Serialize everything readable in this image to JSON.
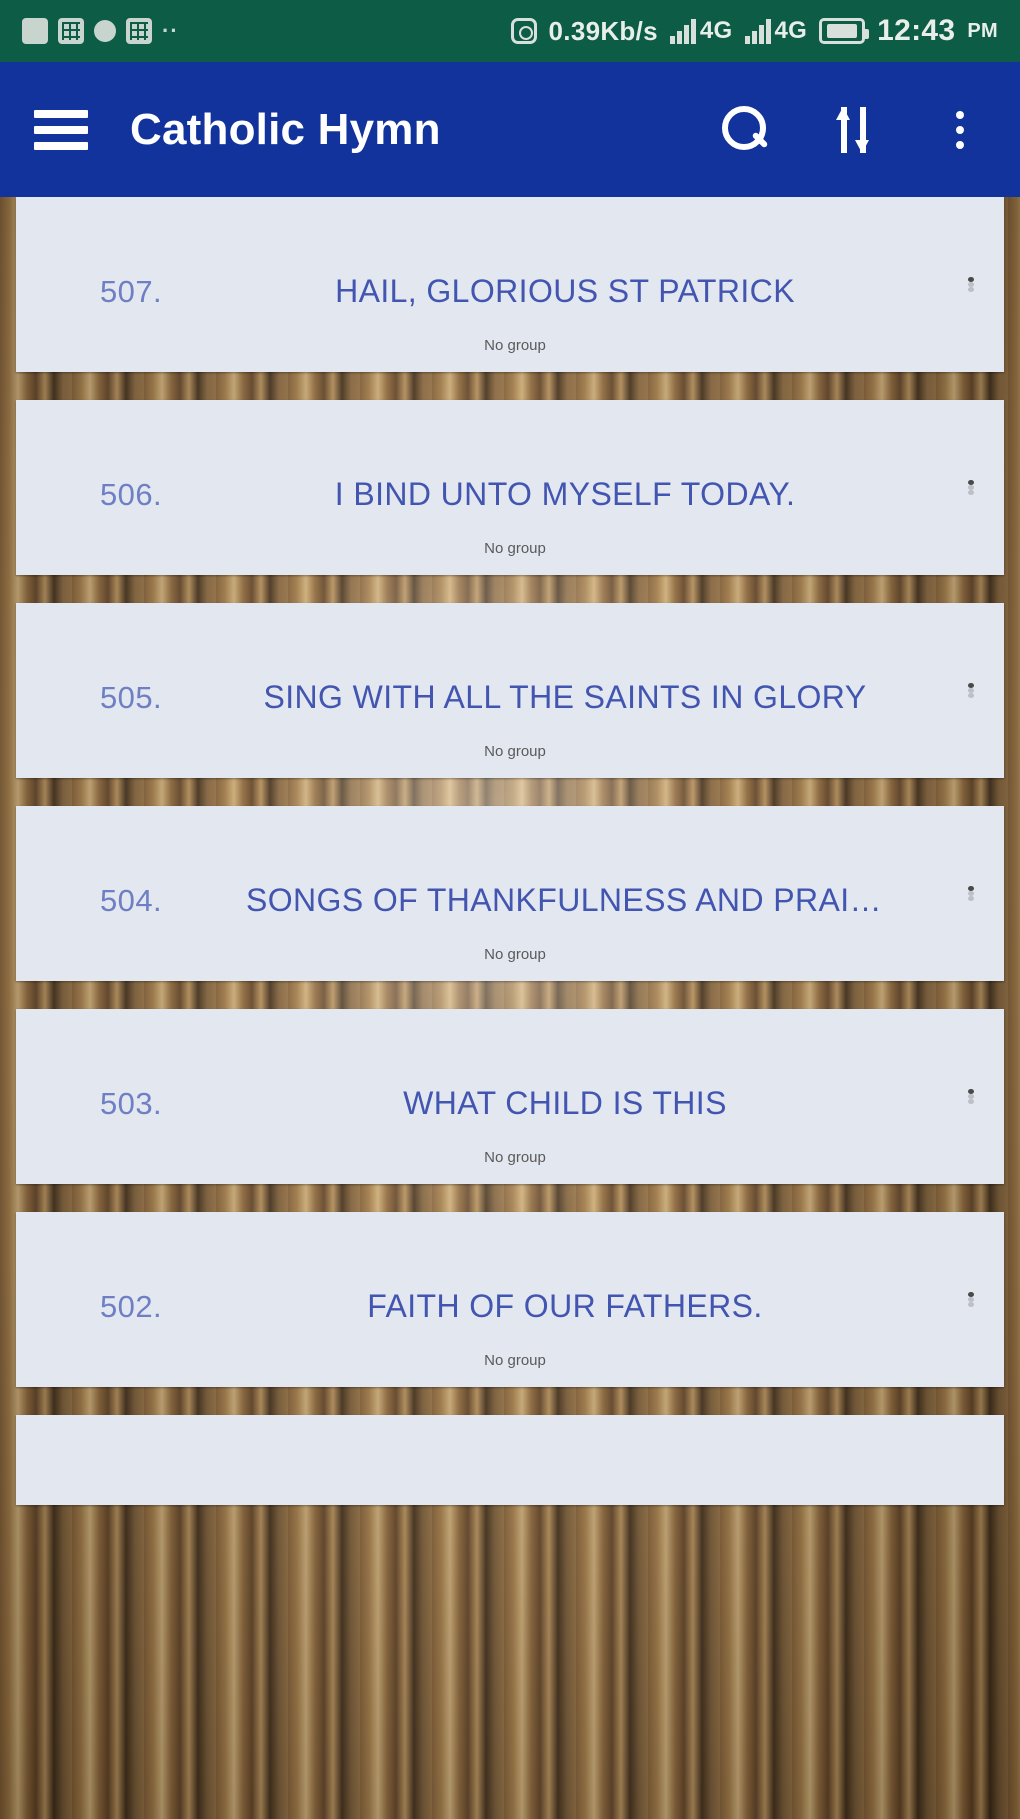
{
  "status_bar": {
    "background_color": "#0d5c46",
    "icons": [
      "sd-card-icon",
      "qr-icon",
      "chat-icon",
      "qr-icon-2"
    ],
    "overflow_dots": "··",
    "network_speed": "0.39Kb/s",
    "signal_1": "4G",
    "signal_2": "4G",
    "battery": "",
    "time": "12:43",
    "ampm": "PM"
  },
  "app_bar": {
    "background_color": "#11339b",
    "title": "Catholic Hymn",
    "menu_icon": "hamburger-icon",
    "actions": [
      {
        "name": "search-icon",
        "label": "Search"
      },
      {
        "name": "sort-icon",
        "label": "Sort"
      },
      {
        "name": "overflow-menu-icon",
        "label": "More options"
      }
    ]
  },
  "list": {
    "card_background": "#e3e7f0",
    "number_color": "#6e7fc4",
    "title_color": "#4255b0",
    "items": [
      {
        "number": "507.",
        "title": "HAIL, GLORIOUS ST PATRICK",
        "group": "No group"
      },
      {
        "number": "506.",
        "title": "I BIND UNTO MYSELF TODAY.",
        "group": "No group"
      },
      {
        "number": "505.",
        "title": "SING WITH ALL THE SAINTS IN GLORY",
        "group": "No group"
      },
      {
        "number": "504.",
        "title": "SONGS OF THANKFULNESS AND PRAISE",
        "group": "No group"
      },
      {
        "number": "503.",
        "title": "WHAT CHILD IS THIS",
        "group": "No group"
      },
      {
        "number": "502.",
        "title": "FAITH OF OUR FATHERS.",
        "group": "No group"
      }
    ]
  }
}
